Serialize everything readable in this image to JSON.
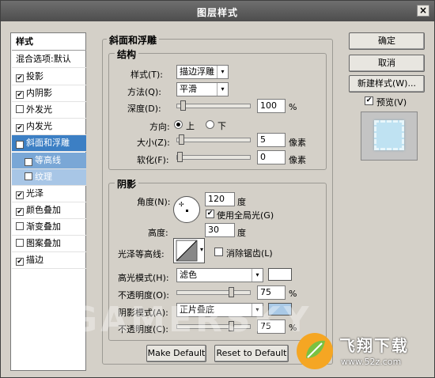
{
  "window": {
    "title": "图层样式",
    "close": "×"
  },
  "sidebar": {
    "items": [
      {
        "label": "样式",
        "checkbox": false
      },
      {
        "label": "混合选项:默认",
        "checkbox": false
      },
      {
        "label": "投影",
        "checkbox": true,
        "checked": true
      },
      {
        "label": "内阴影",
        "checkbox": true,
        "checked": true
      },
      {
        "label": "外发光",
        "checkbox": true,
        "checked": false
      },
      {
        "label": "内发光",
        "checkbox": true,
        "checked": true
      },
      {
        "label": "斜面和浮雕",
        "checkbox": true,
        "checked": true,
        "selected": true
      },
      {
        "label": "等高线",
        "checkbox": true,
        "checked": true,
        "sub": true
      },
      {
        "label": "纹理",
        "checkbox": true,
        "checked": false,
        "sub": true
      },
      {
        "label": "光泽",
        "checkbox": true,
        "checked": true
      },
      {
        "label": "颜色叠加",
        "checkbox": true,
        "checked": true
      },
      {
        "label": "渐变叠加",
        "checkbox": true,
        "checked": false
      },
      {
        "label": "图案叠加",
        "checkbox": true,
        "checked": false
      },
      {
        "label": "描边",
        "checkbox": true,
        "checked": true
      }
    ]
  },
  "bevel": {
    "title": "斜面和浮雕",
    "structure": {
      "title": "结构",
      "style_label": "样式(T):",
      "style_value": "描边浮雕",
      "technique_label": "方法(Q):",
      "technique_value": "平滑",
      "depth_label": "深度(D):",
      "depth_value": "100",
      "depth_unit": "%",
      "depth_slider": 0.05,
      "direction_label": "方向:",
      "dir_up": "上",
      "dir_down": "下",
      "size_label": "大小(Z):",
      "size_value": "5",
      "size_unit": "像素",
      "size_slider": 0.02,
      "soften_label": "软化(F):",
      "soften_value": "0",
      "soften_unit": "像素",
      "soften_slider": 0.0
    },
    "shading": {
      "title": "阴影",
      "angle_label": "角度(N):",
      "angle_value": "120",
      "angle_unit": "度",
      "global_light_label": "使用全局光(G)",
      "altitude_label": "高度:",
      "altitude_value": "30",
      "altitude_unit": "度",
      "gloss_label": "光泽等高线:",
      "antialias_label": "消除锯齿(L)",
      "highlight_mode_label": "高光模式(H):",
      "highlight_mode_value": "滤色",
      "highlight_color": "#ffffff",
      "highlight_opacity_label": "不透明度(O):",
      "highlight_opacity_value": "75",
      "highlight_opacity_unit": "%",
      "highlight_opacity_slider": 0.75,
      "shadow_mode_label": "阴影模式(A):",
      "shadow_mode_value": "正片叠底",
      "shadow_color": "#a9c9e6",
      "shadow_opacity_label": "不透明度(C):",
      "shadow_opacity_value": "75",
      "shadow_opacity_unit": "%",
      "shadow_opacity_slider": 0.75
    },
    "make_default": "Make Default",
    "reset_default": "Reset to Default"
  },
  "actions": {
    "ok": "确定",
    "cancel": "取消",
    "new_style": "新建样式(W)...",
    "preview_label": "预览(V)"
  },
  "watermark": "GAMERSKY",
  "logo": {
    "name": "飞翔下载",
    "url": "www.52z.com"
  }
}
